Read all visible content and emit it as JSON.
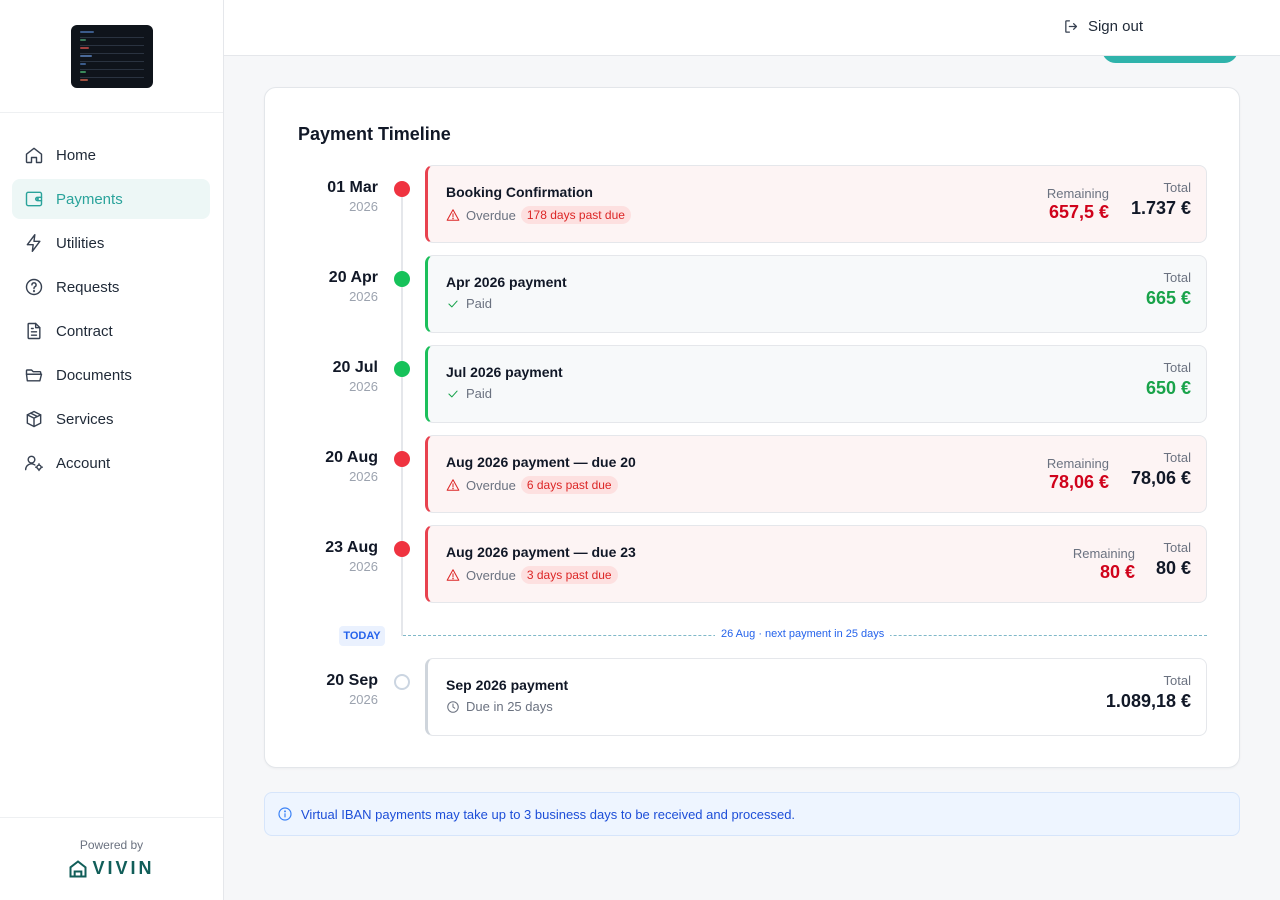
{
  "header": {
    "signout_label": "Sign out"
  },
  "sidebar": {
    "items": [
      {
        "label": "Home",
        "icon": "home-icon"
      },
      {
        "label": "Payments",
        "icon": "wallet-icon",
        "active": true
      },
      {
        "label": "Utilities",
        "icon": "bolt-icon"
      },
      {
        "label": "Requests",
        "icon": "help-circle-icon"
      },
      {
        "label": "Contract",
        "icon": "file-text-icon"
      },
      {
        "label": "Documents",
        "icon": "folder-icon"
      },
      {
        "label": "Services",
        "icon": "box-icon"
      },
      {
        "label": "Account",
        "icon": "user-cog-icon"
      }
    ],
    "powered_by": "Powered by",
    "brand": "VIVIN"
  },
  "timeline": {
    "title": "Payment Timeline",
    "payments": [
      {
        "day": "01 Mar",
        "year": "2026",
        "name": "Booking Confirmation",
        "status": "Overdue",
        "badge": "178 days past due",
        "remaining_label": "Remaining",
        "remaining": "657,5 €",
        "total_label": "Total",
        "total": "1.737 €"
      },
      {
        "day": "20 Apr",
        "year": "2026",
        "name": "Apr 2026 payment",
        "status": "Paid",
        "total_label": "Total",
        "total": "665 €"
      },
      {
        "day": "20 Jul",
        "year": "2026",
        "name": "Jul 2026 payment",
        "status": "Paid",
        "total_label": "Total",
        "total": "650 €"
      },
      {
        "day": "20 Aug",
        "year": "2026",
        "name": "Aug 2026 payment — due 20",
        "status": "Overdue",
        "badge": "6 days past due",
        "remaining_label": "Remaining",
        "remaining": "78,06 €",
        "total_label": "Total",
        "total": "78,06 €"
      },
      {
        "day": "23 Aug",
        "year": "2026",
        "name": "Aug 2026 payment — due 23",
        "status": "Overdue",
        "badge": "3 days past due",
        "remaining_label": "Remaining",
        "remaining": "80 €",
        "total_label": "Total",
        "total": "80 €"
      },
      {
        "day": "20 Sep",
        "year": "2026",
        "name": "Sep 2026 payment",
        "status": "Due in 25 days",
        "total_label": "Total",
        "total": "1.089,18 €"
      }
    ],
    "today_badge": "TODAY",
    "today_text": "26 Aug · next payment in 25 days"
  },
  "notice": {
    "text": "Virtual IBAN payments may take up to 3 business days to be received and processed."
  },
  "colors": {
    "accent": "#2aa39b",
    "overdue": "#d0021b",
    "paid": "#19a34a",
    "info": "#1d4ed8"
  }
}
